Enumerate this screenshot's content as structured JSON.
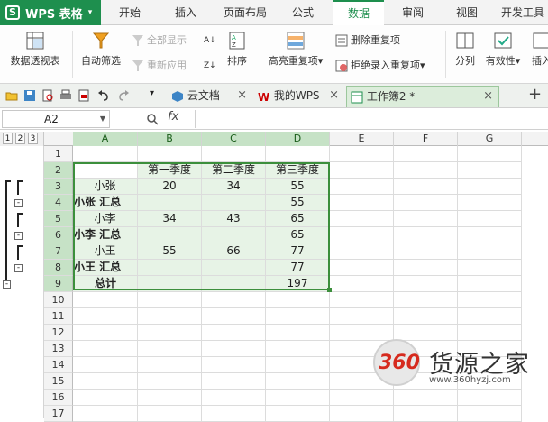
{
  "app": {
    "title": "WPS 表格",
    "logo": "S"
  },
  "menu_tabs": [
    {
      "label": "开始"
    },
    {
      "label": "插入"
    },
    {
      "label": "页面布局"
    },
    {
      "label": "公式"
    },
    {
      "label": "数据",
      "active": true
    },
    {
      "label": "审阅"
    },
    {
      "label": "视图"
    },
    {
      "label": "开发工具"
    }
  ],
  "ribbon": {
    "pivot": "数据透视表",
    "autofilter": "自动筛选",
    "show_all": "全部显示",
    "reapply": "重新应用",
    "sort": "排序",
    "highlight_dup": "高亮重复项",
    "remove_dup": "删除重复项",
    "reject_dup": "拒绝录入重复项",
    "split": "分列",
    "validity": "有效性",
    "insert": "插入"
  },
  "doc_tabs": [
    {
      "label": "云文档"
    },
    {
      "label": "我的WPS"
    },
    {
      "label": "工作簿2 *",
      "active": true
    }
  ],
  "formula_bar": {
    "cell_ref": "A2",
    "fx": "fx",
    "formula": ""
  },
  "outline_levels": [
    "1",
    "2",
    "3"
  ],
  "columns": [
    "A",
    "B",
    "C",
    "D",
    "E",
    "F",
    "G"
  ],
  "row_numbers": [
    "1",
    "2",
    "3",
    "4",
    "5",
    "6",
    "7",
    "8",
    "9",
    "10",
    "11",
    "12",
    "13",
    "14",
    "15",
    "16",
    "17"
  ],
  "cells": {
    "B2": "第一季度",
    "C2": "第二季度",
    "D2": "第三季度",
    "A3": "小张",
    "B3": "20",
    "C3": "34",
    "D3": "55",
    "A4": "小张 汇总",
    "D4": "55",
    "A5": "小李",
    "B5": "34",
    "C5": "43",
    "D5": "65",
    "A6": "小李 汇总",
    "D6": "65",
    "A7": "小王",
    "B7": "55",
    "C7": "66",
    "D7": "77",
    "A8": "小王 汇总",
    "D8": "77",
    "A9": "总计",
    "D9": "197"
  },
  "watermark": {
    "brand": "360",
    "name": "货源之家",
    "url": "www.360hyzj.com"
  },
  "colors": {
    "brand_green": "#1e8f4e",
    "selection": "#3c8f3c"
  }
}
